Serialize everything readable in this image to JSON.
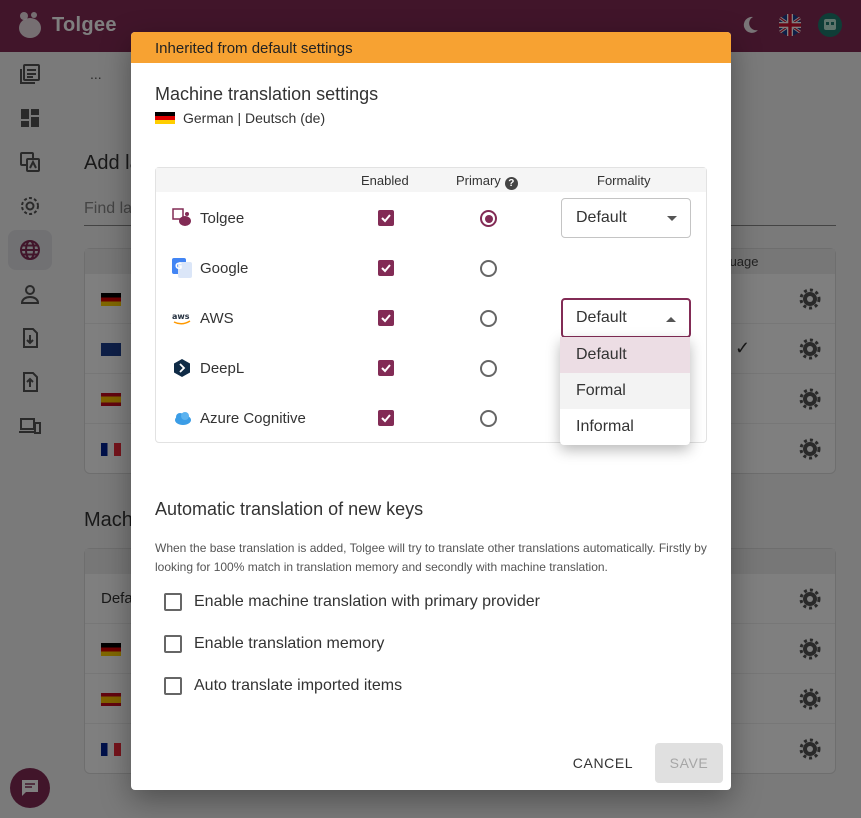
{
  "app": {
    "name": "Tolgee",
    "brand_color": "#822b55"
  },
  "background": {
    "breadcrumb_more": "...",
    "section1_title": "Add la",
    "find_placeholder": "Find la",
    "table1_header": "language",
    "section2_title": "Mach",
    "table2_first_cell": "Defa"
  },
  "dialog": {
    "banner": "Inherited from default settings",
    "banner_color": "#f7a232",
    "title": "Machine translation settings",
    "language": "German | Deutsch (de)",
    "columns": {
      "enabled": "Enabled",
      "primary": "Primary",
      "primary_help_icon": "help-icon",
      "formality": "Formality"
    },
    "providers": [
      {
        "name": "Tolgee",
        "icon": "tolgee-icon",
        "enabled": true,
        "primary": true,
        "formality": "Default"
      },
      {
        "name": "Google",
        "icon": "google-translate-icon",
        "enabled": true,
        "primary": false
      },
      {
        "name": "AWS",
        "icon": "aws-icon",
        "enabled": true,
        "primary": false,
        "formality": "Default"
      },
      {
        "name": "DeepL",
        "icon": "deepl-icon",
        "enabled": true,
        "primary": false
      },
      {
        "name": "Azure Cognitive",
        "icon": "azure-icon",
        "enabled": true,
        "primary": false
      }
    ],
    "formality_menu": {
      "options": [
        "Default",
        "Formal",
        "Informal"
      ],
      "selected": "Default"
    },
    "auto": {
      "title": "Automatic translation of new keys",
      "description": "When the base translation is added, Tolgee will try to translate other translations automatically. Firstly by looking for 100% match in translation memory and secondly with machine translation.",
      "options": [
        {
          "label": "Enable machine translation with primary provider",
          "checked": false
        },
        {
          "label": "Enable translation memory",
          "checked": false
        },
        {
          "label": "Auto translate imported items",
          "checked": false
        }
      ]
    },
    "buttons": {
      "cancel": "CANCEL",
      "save": "SAVE"
    }
  }
}
